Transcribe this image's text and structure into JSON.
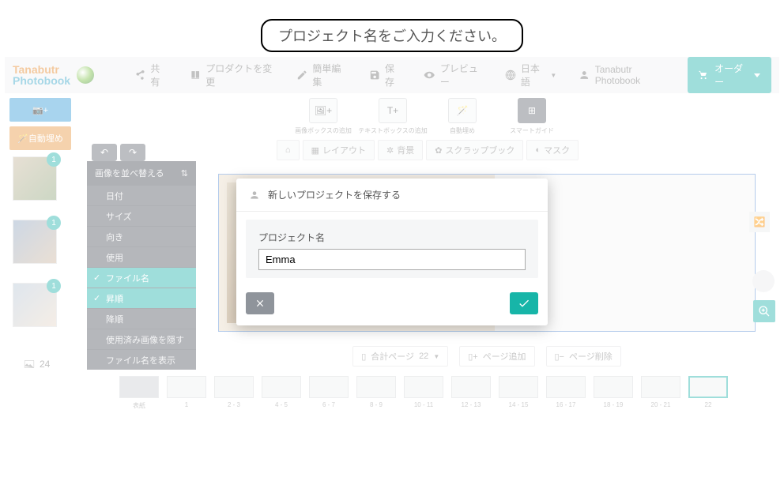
{
  "callout": "プロジェクト名をご入力ください。",
  "logo": {
    "line1": "Tanabutr",
    "line2": "Photobook"
  },
  "header": {
    "share": "共有",
    "change_product": "プロダクトを変更",
    "easy_edit": "簡単編集",
    "save": "保存",
    "preview": "プレビュー",
    "language": "日本語",
    "user": "Tanabutr Photobook",
    "order": "オーダー"
  },
  "left_buttons": {
    "add_images": "📷+",
    "auto_fill": "自動埋め"
  },
  "thumbs": {
    "count": "24",
    "badge": "1"
  },
  "sort_panel": {
    "title": "画像を並べ替える",
    "items": [
      "日付",
      "サイズ",
      "向き",
      "使用",
      "ファイル名",
      "昇順",
      "降順",
      "使用済み画像を隠す",
      "ファイル名を表示"
    ]
  },
  "big_actions": {
    "add_imgbox": "画像ボックスの追加",
    "add_textbox": "テキストボックスの追加",
    "auto_fill": "自動埋め",
    "smart_guide": "スマートガイド"
  },
  "toolbar2": {
    "layout": "レイアウト",
    "background": "背景",
    "scrapbook": "スクラップブック",
    "mask": "マスク"
  },
  "page_controls": {
    "total_pages_label": "合計ページ",
    "total_pages_value": "22",
    "add_page": "ページ追加",
    "delete_page": "ページ削除"
  },
  "page_strip": [
    "表紙",
    "1",
    "2 - 3",
    "4 - 5",
    "6 - 7",
    "8 - 9",
    "10 - 11",
    "12 - 13",
    "14 - 15",
    "16 - 17",
    "18 - 19",
    "20 - 21",
    "22"
  ],
  "modal": {
    "title": "新しいプロジェクトを保存する",
    "field_label": "プロジェクト名",
    "value": "Emma"
  }
}
